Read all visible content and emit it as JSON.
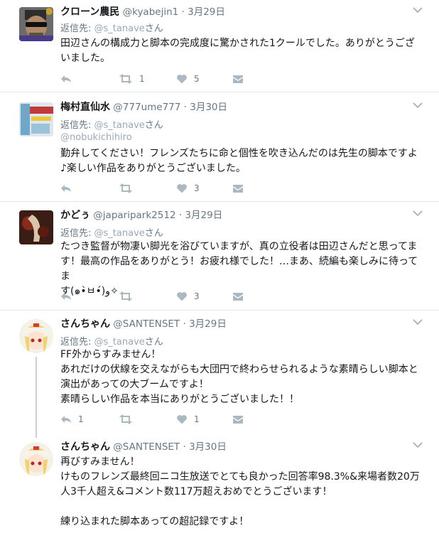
{
  "icons": {
    "reply": "reply-icon",
    "retweet": "retweet-icon",
    "like": "heart-icon",
    "dm": "envelope-icon",
    "more": "chevron-down-icon"
  },
  "colors": {
    "icon": "#aab8c2",
    "text_secondary": "#657786",
    "link": "#9aa8b4",
    "divider": "#e1e8ed"
  },
  "tweets": [
    {
      "name": "クローン農民",
      "handle": "@kyabejin1",
      "date": "3月29日",
      "reply_to_label": "返信先:",
      "reply_to": "@s_tanave",
      "reply_suffix": "さん",
      "body": [
        "田辺さんの構成力と脚本の完成度に驚かされた1クールでした。ありがとうござ",
        "いました。"
      ],
      "retweets": "1",
      "likes": "5"
    },
    {
      "name": "梅村直仙水",
      "handle": "@777ume777",
      "date": "3月30日",
      "reply_to_label": "返信先:",
      "reply_to": "@s_tanave",
      "reply_suffix": "さん",
      "mention_line": "@nobukichihiro",
      "body": [
        "勤弁してください！フレンズたちに命と個性を吹き込んだのは先生の脚本ですよ",
        "♪楽しい作品をありがとうございました。"
      ],
      "likes": "3"
    },
    {
      "name": "かどぅ",
      "handle": "@japaripark2512",
      "date": "3月29日",
      "reply_to_label": "返信先:",
      "reply_to": "@s_tanave",
      "reply_suffix": "さん",
      "body": [
        "たつき監督が物凄い脚光を浴びていますが、真の立役者は田辺さんだと思ってま",
        "す！最高の作品をありがとう！お疲れ様でした！…まあ、続編も楽しみに待ってま",
        "す(๑•̀ㅂ•́)و✧"
      ],
      "likes": "3"
    },
    {
      "name": "さんちゃん",
      "handle": "@SANTENSET",
      "date": "3月29日",
      "reply_to_label": "返信先:",
      "reply_to": "@s_tanave",
      "reply_suffix": "さん",
      "body": [
        "FF外からすみません！",
        "あれだけの伏線を交えながらも大団円で終わらせられるような素晴らしい脚本と",
        "演出があっての大ブームですよ！",
        "素晴らしい作品を本当にありがとうございました！！"
      ],
      "replies": "1",
      "likes": "1"
    },
    {
      "name": "さんちゃん",
      "handle": "@SANTENSET",
      "date": "3月30日",
      "body": [
        "再びすみません！",
        "けものフレンズ最終回ニコ生放送でとても良かった回答率98.3%&来場者数20万",
        "人3千人超え&コメント数117万超えおめでとうございます！",
        "",
        "練り込まれた脚本あっての超記録ですよ！"
      ]
    }
  ]
}
